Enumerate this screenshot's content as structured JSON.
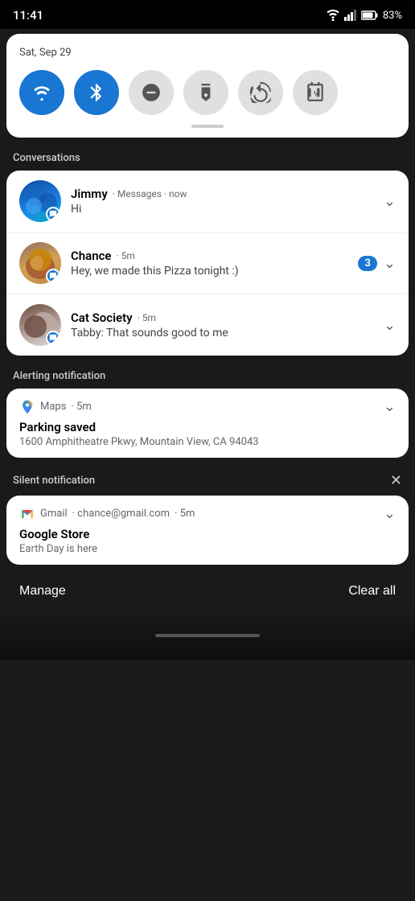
{
  "statusBar": {
    "time": "11:41",
    "battery": "83%",
    "wifiIcon": "wifi-icon",
    "signalIcon": "signal-icon",
    "batteryIcon": "battery-icon"
  },
  "quickSettings": {
    "date": "Sat, Sep 29",
    "tiles": [
      {
        "id": "wifi",
        "label": "Wi-Fi",
        "active": true
      },
      {
        "id": "bluetooth",
        "label": "Bluetooth",
        "active": true
      },
      {
        "id": "dnd",
        "label": "Do Not Disturb",
        "active": false
      },
      {
        "id": "flashlight",
        "label": "Flashlight",
        "active": false
      },
      {
        "id": "rotation",
        "label": "Auto Rotate",
        "active": false
      },
      {
        "id": "battery-saver",
        "label": "Battery Saver",
        "active": false
      }
    ]
  },
  "sections": {
    "conversations": {
      "label": "Conversations",
      "items": [
        {
          "id": "jimmy",
          "name": "Jimmy",
          "app": "Messages",
          "time": "now",
          "text": "Hi",
          "unread": 0
        },
        {
          "id": "chance",
          "name": "Chance",
          "app": "",
          "time": "5m",
          "text": "Hey, we made this Pizza tonight :)",
          "unread": 3
        },
        {
          "id": "cat-society",
          "name": "Cat Society",
          "app": "",
          "time": "5m",
          "text": "Tabby: That sounds good to me",
          "unread": 0
        }
      ]
    },
    "alerting": {
      "label": "Alerting notification",
      "items": [
        {
          "id": "maps",
          "app": "Maps",
          "time": "5m",
          "title": "Parking saved",
          "text": "1600 Amphitheatre Pkwy, Mountain View, CA 94043"
        }
      ]
    },
    "silent": {
      "label": "Silent notification",
      "items": [
        {
          "id": "gmail",
          "app": "Gmail",
          "email": "chance@gmail.com",
          "time": "5m",
          "title": "Google Store",
          "text": "Earth Day is here"
        }
      ]
    }
  },
  "bottomBar": {
    "manageLabel": "Manage",
    "clearAllLabel": "Clear all"
  }
}
